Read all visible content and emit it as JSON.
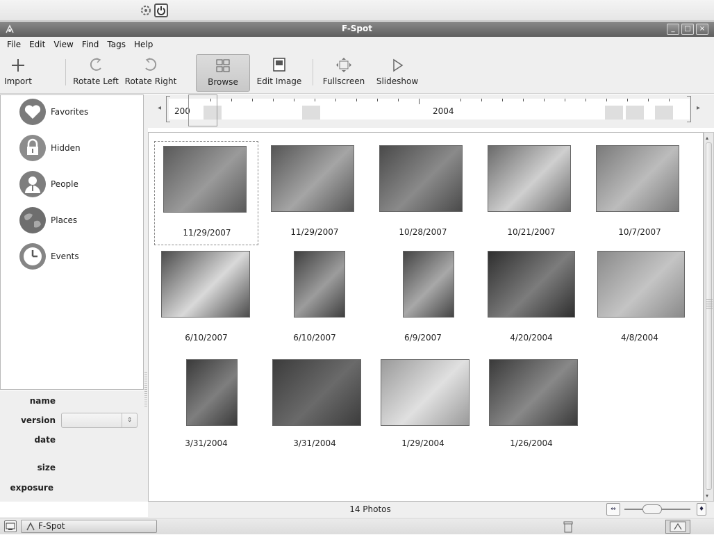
{
  "window": {
    "title": "F-Spot",
    "controls": {
      "minimize": "_",
      "maximize": "□",
      "close": "×"
    }
  },
  "menubar": {
    "items": [
      "File",
      "Edit",
      "View",
      "Find",
      "Tags",
      "Help"
    ]
  },
  "toolbar": {
    "import_label": "Import",
    "rotate_left_label": "Rotate Left",
    "rotate_right_label": "Rotate Right",
    "browse_label": "Browse",
    "edit_image_label": "Edit Image",
    "fullscreen_label": "Fullscreen",
    "slideshow_label": "Slideshow",
    "active_view": "Browse"
  },
  "sidebar": {
    "tags": [
      {
        "label": "Favorites",
        "icon": "heart-icon"
      },
      {
        "label": "Hidden",
        "icon": "lock-icon"
      },
      {
        "label": "People",
        "icon": "people-icon"
      },
      {
        "label": "Places",
        "icon": "globe-icon"
      },
      {
        "label": "Events",
        "icon": "clock-icon"
      }
    ]
  },
  "info": {
    "name_label": "name",
    "version_label": "version",
    "date_label": "date",
    "size_label": "size",
    "exposure_label": "exposure",
    "version_value": ""
  },
  "timeline": {
    "year_left": "200",
    "year_right": "2004"
  },
  "photos": [
    {
      "date": "11/29/2007",
      "selected": true
    },
    {
      "date": "11/29/2007"
    },
    {
      "date": "10/28/2007"
    },
    {
      "date": "10/21/2007"
    },
    {
      "date": "10/7/2007"
    },
    {
      "date": "6/10/2007"
    },
    {
      "date": "6/10/2007"
    },
    {
      "date": "6/9/2007"
    },
    {
      "date": "4/20/2004"
    },
    {
      "date": "4/8/2004"
    },
    {
      "date": "3/31/2004"
    },
    {
      "date": "3/31/2004"
    },
    {
      "date": "1/29/2004"
    },
    {
      "date": "1/26/2004"
    }
  ],
  "status": {
    "photo_count": "14 Photos"
  },
  "taskbar": {
    "task_label": "F-Spot"
  },
  "colors": {
    "titlebar": "#6f6f6f",
    "window_bg": "#efefef",
    "content_bg": "#ffffff"
  }
}
